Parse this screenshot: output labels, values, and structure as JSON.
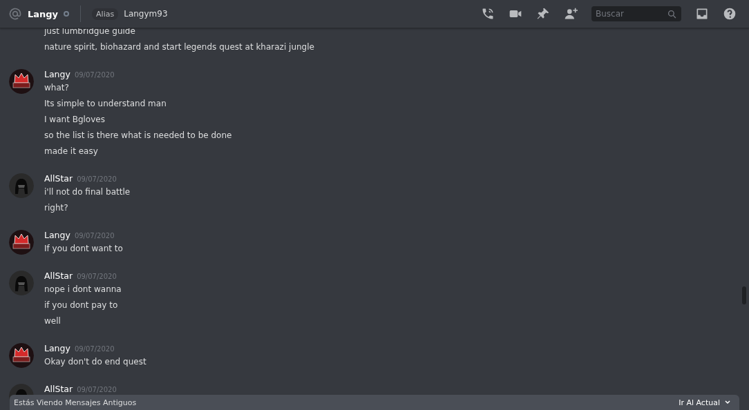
{
  "header": {
    "name": "Langy",
    "alias_label": "Alias",
    "alias": "Langym93",
    "search": {
      "placeholder": "Buscar"
    }
  },
  "top_lines": [
    "just lumbridgue guide",
    "nature spirit, biohazard and start legends quest at kharazi jungle"
  ],
  "messages": [
    {
      "author": "Langy",
      "kind": "crown",
      "date": "09/07/2020",
      "lines": [
        "what?",
        "Its simple to understand man",
        "I want Bgloves",
        "so the list is there what is needed to be done",
        "made it easy"
      ]
    },
    {
      "author": "AllStar",
      "kind": "helmet",
      "date": "09/07/2020",
      "lines": [
        "i'll not do final battle",
        "right?"
      ]
    },
    {
      "author": "Langy",
      "kind": "crown",
      "date": "09/07/2020",
      "lines": [
        "If you dont want to"
      ]
    },
    {
      "author": "AllStar",
      "kind": "helmet",
      "date": "09/07/2020",
      "lines": [
        "nope i dont wanna",
        "if you dont pay to",
        "well"
      ]
    },
    {
      "author": "Langy",
      "kind": "crown",
      "date": "09/07/2020",
      "lines": [
        "Okay don't do end quest"
      ]
    },
    {
      "author": "AllStar",
      "kind": "helmet",
      "date": "09/07/2020"
    }
  ],
  "jump_bar": {
    "text": "Estás Viendo Mensajes Antiguos",
    "action": "Ir Al Actual"
  }
}
